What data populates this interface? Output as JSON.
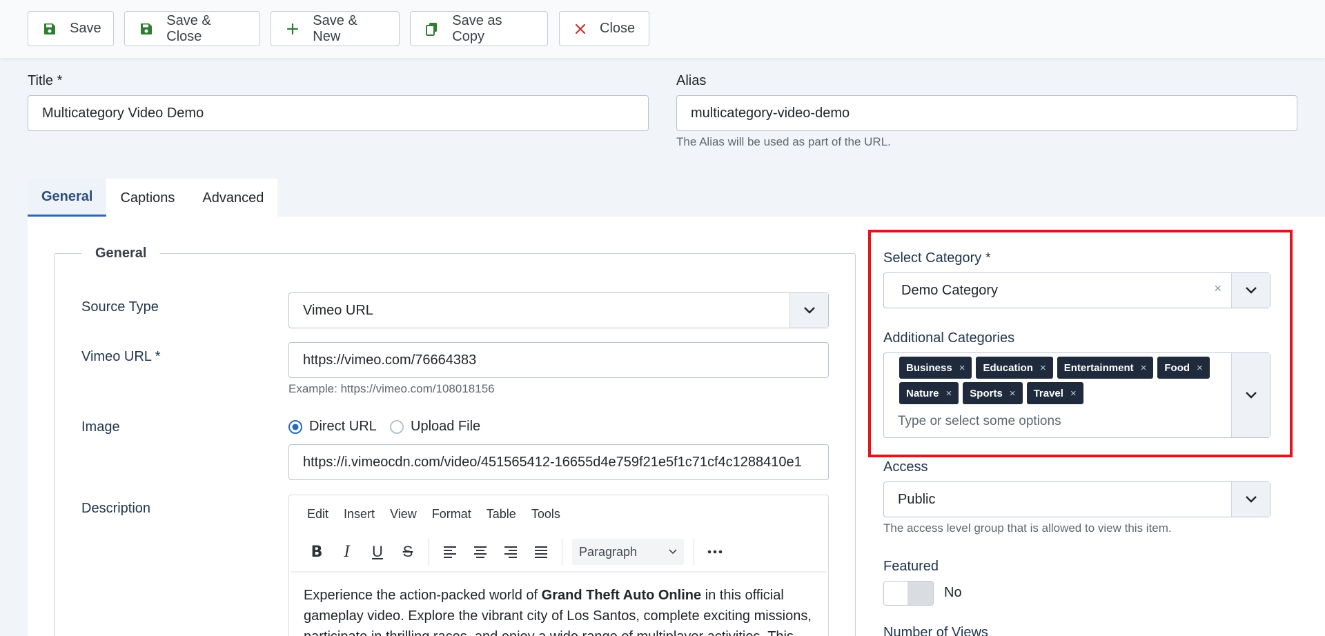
{
  "toolbar": {
    "save": "Save",
    "save_close": "Save & Close",
    "save_new": "Save & New",
    "save_copy": "Save as Copy",
    "close": "Close"
  },
  "title": {
    "label": "Title *",
    "value": "Multicategory Video Demo"
  },
  "alias": {
    "label": "Alias",
    "value": "multicategory-video-demo",
    "hint": "The Alias will be used as part of the URL."
  },
  "tabs": [
    "General",
    "Captions",
    "Advanced"
  ],
  "general": {
    "legend": "General",
    "source_type": {
      "label": "Source Type",
      "value": "Vimeo URL"
    },
    "vimeo_url": {
      "label": "Vimeo URL *",
      "value": "https://vimeo.com/76664383",
      "hint": "Example: https://vimeo.com/108018156"
    },
    "image": {
      "label": "Image",
      "options": [
        "Direct URL",
        "Upload File"
      ],
      "selected": "Direct URL",
      "value": "https://i.vimeocdn.com/video/451565412-16655d4e759f21e5f1c71cf4c1288410e1"
    },
    "description": {
      "label": "Description",
      "menu": [
        "Edit",
        "Insert",
        "View",
        "Format",
        "Table",
        "Tools"
      ],
      "block_format": "Paragraph",
      "text_before": "Experience the action-packed world of ",
      "text_bold": "Grand Theft Auto Online",
      "text_after": " in this official gameplay video. Explore the vibrant city of Los Santos, complete exciting missions, participate in thrilling races, and enjoy a wide range of multiplayer activities. This"
    }
  },
  "sidebar": {
    "category": {
      "label": "Select Category *",
      "value": "Demo Category"
    },
    "additional": {
      "label": "Additional Categories",
      "chips": [
        "Business",
        "Education",
        "Entertainment",
        "Food",
        "Nature",
        "Sports",
        "Travel"
      ],
      "placeholder": "Type or select some options"
    },
    "access": {
      "label": "Access",
      "value": "Public",
      "hint": "The access level group that is allowed to view this item."
    },
    "featured": {
      "label": "Featured",
      "value": "No"
    },
    "views": {
      "label": "Number of Views"
    }
  },
  "colors": {
    "accent": "#2a69b8",
    "highlight": "#e3141b",
    "chip": "#1f2b3d",
    "save_icon": "#2e7d32",
    "close_icon": "#d32f2f"
  }
}
